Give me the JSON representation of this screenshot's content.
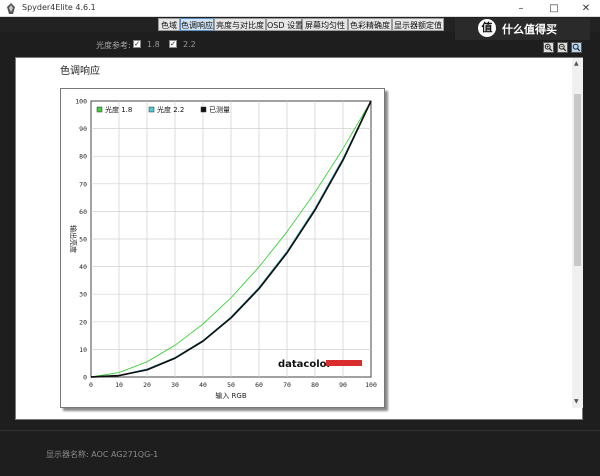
{
  "window": {
    "title": "Spyder4Elite 4.6.1"
  },
  "tabs": [
    {
      "label": "色域",
      "active": false
    },
    {
      "label": "色调响应",
      "active": true
    },
    {
      "label": "亮度与对比度",
      "active": false
    },
    {
      "label": "OSD 设置",
      "active": false
    },
    {
      "label": "屏幕均匀性",
      "active": false
    },
    {
      "label": "色彩精确度",
      "active": false
    },
    {
      "label": "显示器额定值",
      "active": false
    }
  ],
  "gamma_ref": {
    "label": "光度参考:",
    "option1": "1.8",
    "option2": "2.2"
  },
  "section_title": "色调响应",
  "chart_data": {
    "type": "line",
    "xlabel": "输入 RGB",
    "ylabel": "输出亮度",
    "xlim": [
      0,
      100
    ],
    "ylim": [
      0,
      100
    ],
    "xticks": [
      0,
      10,
      20,
      30,
      40,
      50,
      60,
      70,
      80,
      90,
      100
    ],
    "yticks": [
      0,
      10,
      20,
      30,
      40,
      50,
      60,
      70,
      80,
      90,
      100
    ],
    "grid": true,
    "legend_position": "top-left",
    "x": [
      0,
      10,
      20,
      30,
      40,
      50,
      60,
      70,
      80,
      90,
      100
    ],
    "series": [
      {
        "name": "光度 1.8",
        "color": "#3fcf3f",
        "values": [
          0,
          1.6,
          5.5,
          11.5,
          19.2,
          28.7,
          39.9,
          52.6,
          66.9,
          82.7,
          100
        ]
      },
      {
        "name": "光度 2.2",
        "color": "#4fc8d8",
        "values": [
          0,
          0.6,
          2.9,
          7.1,
          13.3,
          21.8,
          32.5,
          45.6,
          61.2,
          79.3,
          100
        ]
      },
      {
        "name": "已测量",
        "color": "#111111",
        "values": [
          0,
          0.5,
          2.6,
          6.8,
          13.0,
          21.4,
          32.0,
          45.0,
          60.5,
          78.6,
          100
        ]
      }
    ],
    "brand": "datacolor"
  },
  "footer": {
    "display_name": "显示器名称: AOC AG271QG-1"
  },
  "watermark": {
    "icon": "值",
    "text": "什么值得买"
  }
}
